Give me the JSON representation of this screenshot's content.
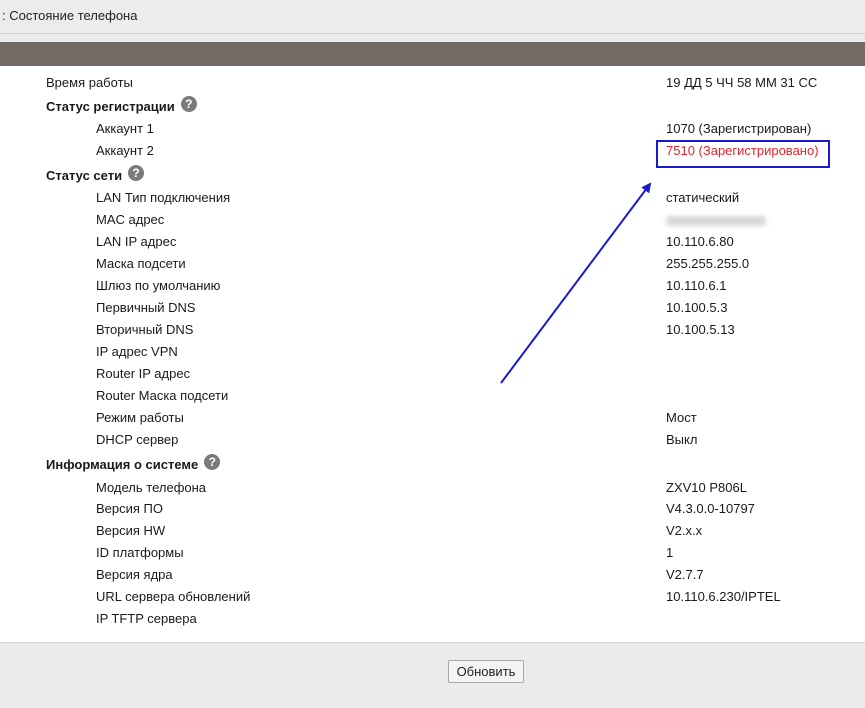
{
  "header": {
    "title": ": Состояние телефона"
  },
  "uptime": {
    "label": "Время работы",
    "value": "19 ДД 5 ЧЧ 58 ММ 31 СС"
  },
  "registration": {
    "title": "Статус регистрации",
    "help_icon": "question-icon",
    "items": [
      {
        "label": "Аккаунт 1",
        "value": "1070 (Зарегистрирован)"
      },
      {
        "label": "Аккаунт 2",
        "value": "7510 (Зарегистрировано)",
        "color": "#e0242b"
      }
    ]
  },
  "network": {
    "title": "Статус сети",
    "help_icon": "question-icon",
    "items": [
      {
        "label": "LAN Тип подключения",
        "value": "статический"
      },
      {
        "label": "MAC адрес",
        "value": ""
      },
      {
        "label": "LAN IP адрес",
        "value": "10.110.6.80"
      },
      {
        "label": "Маска подсети",
        "value": "255.255.255.0"
      },
      {
        "label": "Шлюз по умолчанию",
        "value": "10.110.6.1"
      },
      {
        "label": "Первичный DNS",
        "value": "10.100.5.3"
      },
      {
        "label": "Вторичный DNS",
        "value": "10.100.5.13"
      },
      {
        "label": "IP адрес VPN",
        "value": ""
      },
      {
        "label": "Router IP адрес",
        "value": ""
      },
      {
        "label": "Router Маска подсети",
        "value": ""
      },
      {
        "label": "Режим работы",
        "value": "Мост"
      },
      {
        "label": "DHCP сервер",
        "value": "Выкл"
      }
    ]
  },
  "system": {
    "title": "Информация о системе",
    "help_icon": "question-icon",
    "items": [
      {
        "label": "Модель телефона",
        "value": "ZXV10 P806L"
      },
      {
        "label": "Версия ПО",
        "value": "V4.3.0.0-10797"
      },
      {
        "label": "Версия HW",
        "value": "V2.x.x"
      },
      {
        "label": "ID платформы",
        "value": "1"
      },
      {
        "label": "Версия ядра",
        "value": "V2.7.7"
      },
      {
        "label": "URL сервера обновлений",
        "value": "10.110.6.230/IPTEL"
      },
      {
        "label": "IP TFTP сервера",
        "value": ""
      }
    ]
  },
  "refresh_button": {
    "label": "Обновить"
  },
  "annotation": {
    "color": "#1a1ad0"
  }
}
